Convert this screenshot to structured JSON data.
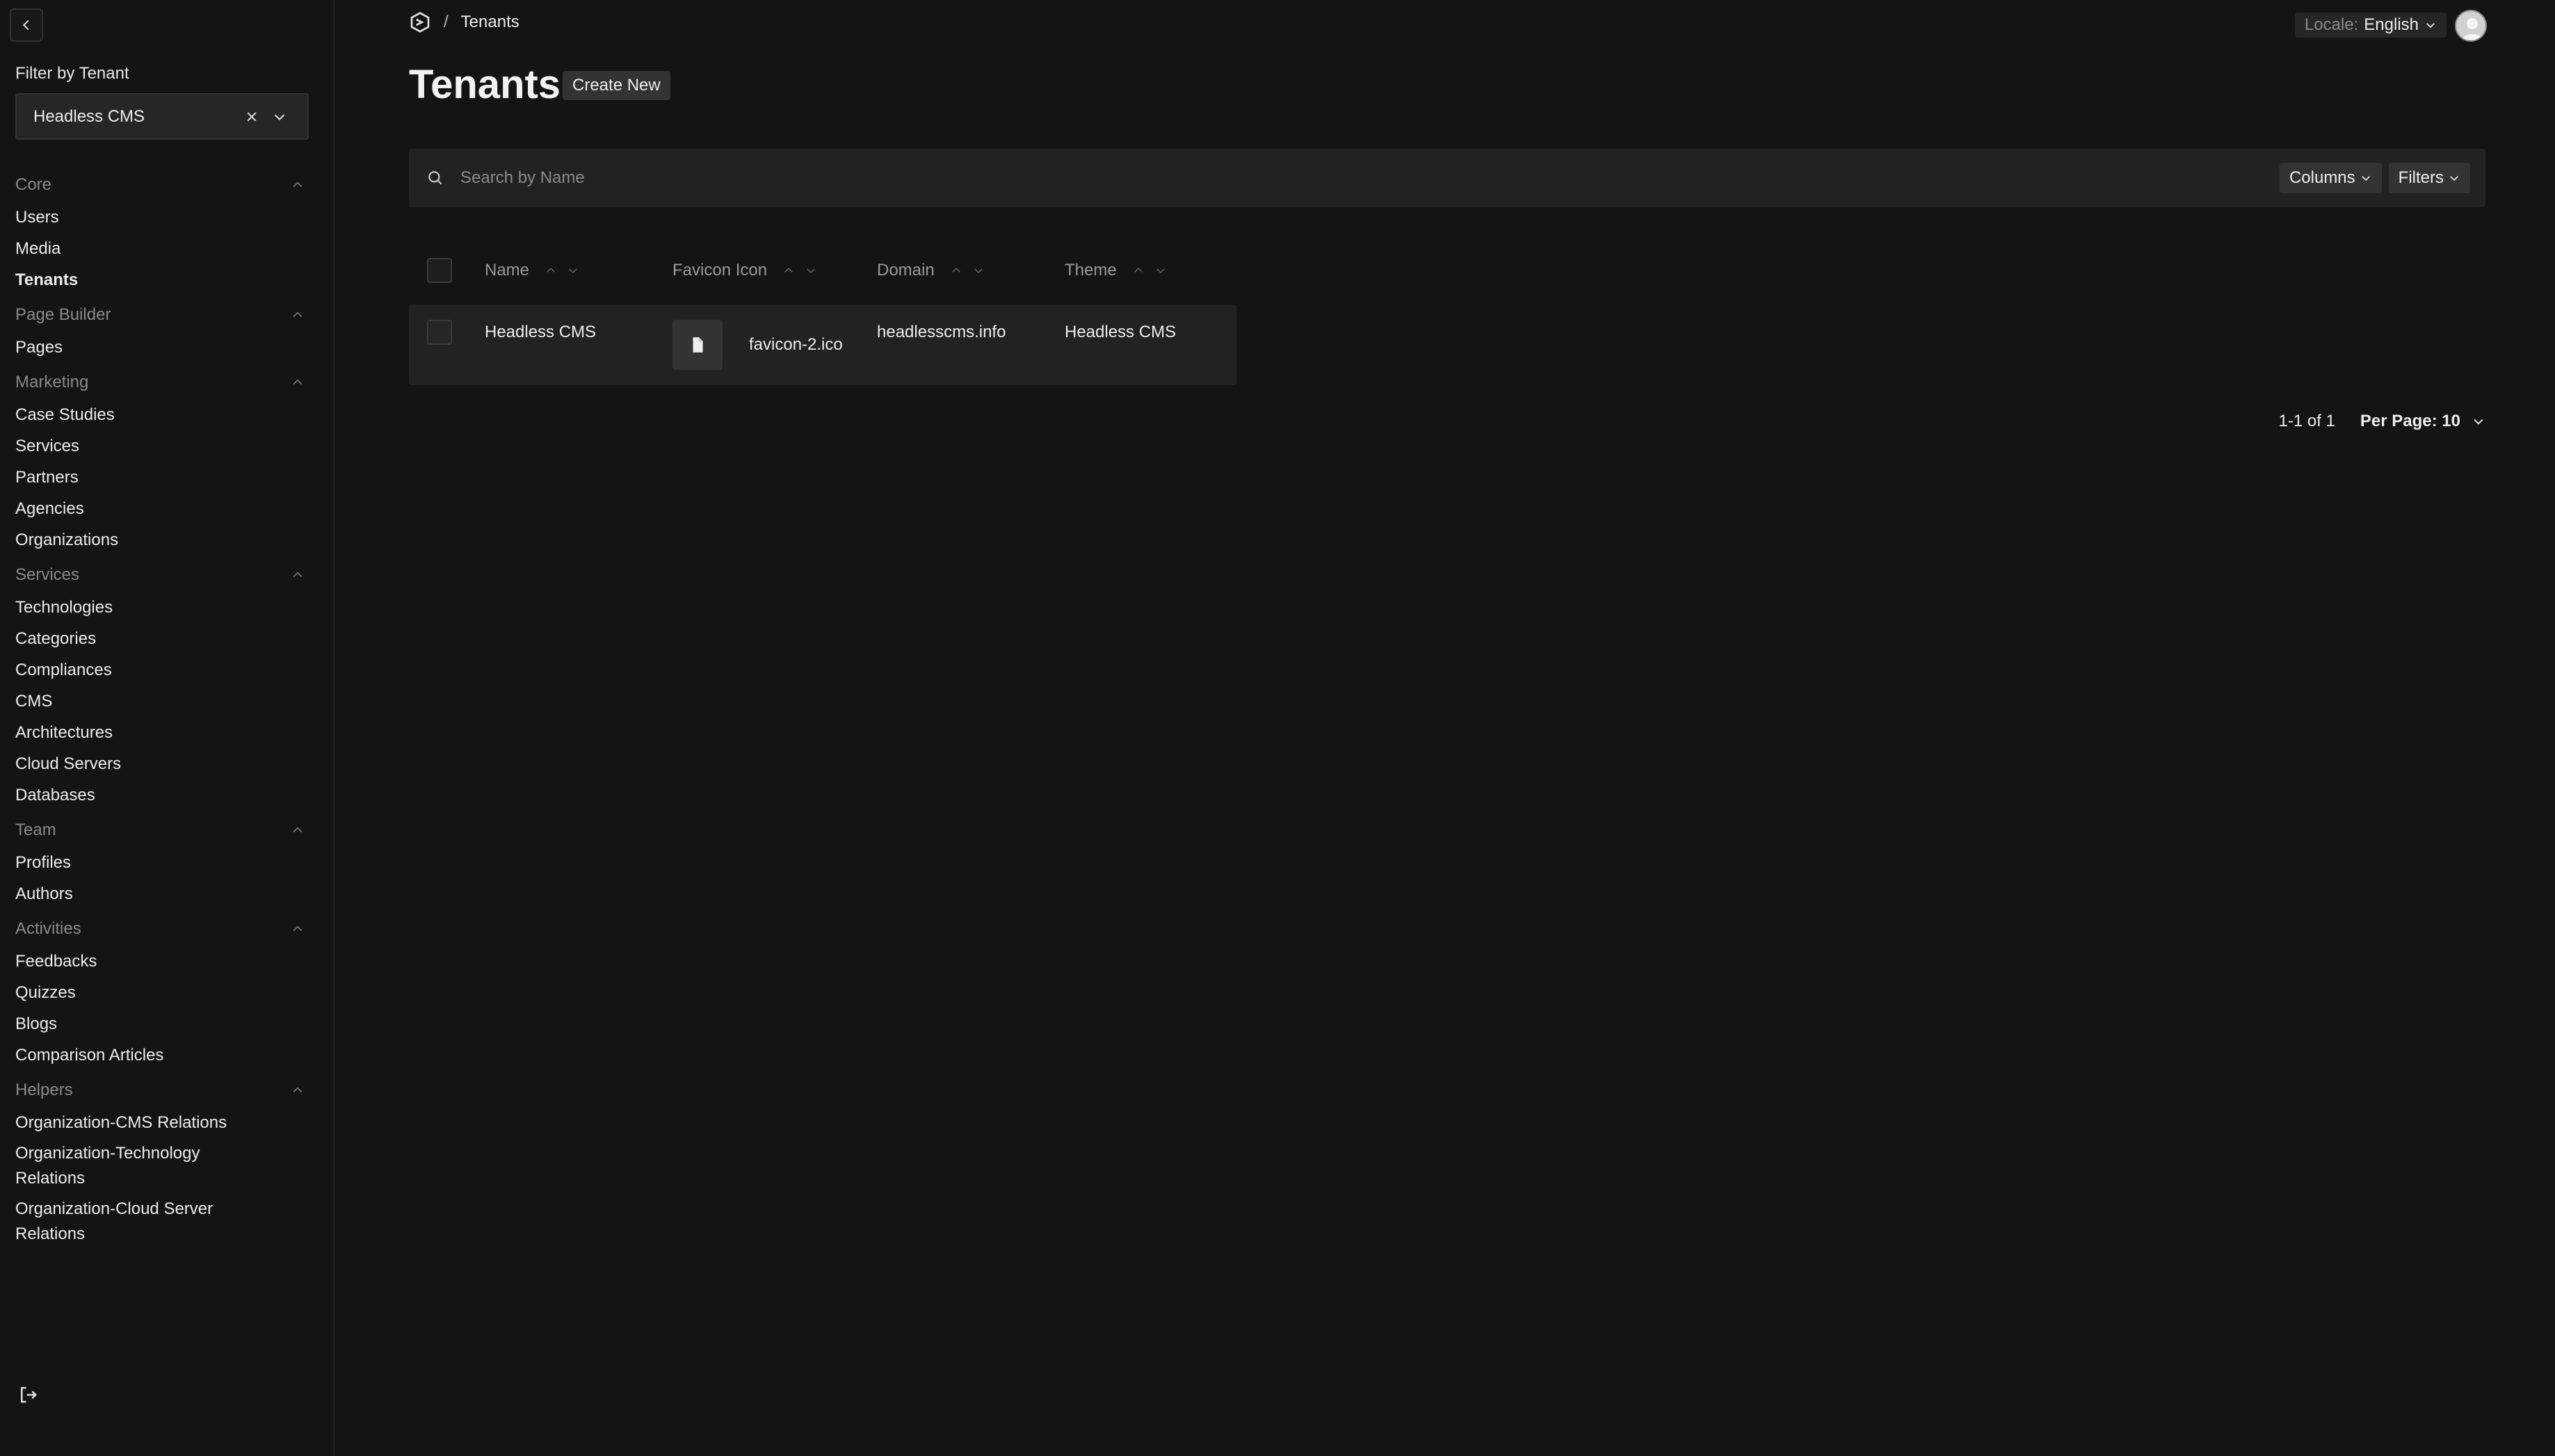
{
  "sidebar": {
    "filter_label": "Filter by Tenant",
    "tenant_value": "Headless CMS",
    "groups": [
      {
        "label": "Core",
        "items": [
          {
            "label": "Users"
          },
          {
            "label": "Media"
          },
          {
            "label": "Tenants",
            "active": true
          }
        ]
      },
      {
        "label": "Page Builder",
        "items": [
          {
            "label": "Pages"
          }
        ]
      },
      {
        "label": "Marketing",
        "items": [
          {
            "label": "Case Studies"
          },
          {
            "label": "Services"
          },
          {
            "label": "Partners"
          },
          {
            "label": "Agencies"
          },
          {
            "label": "Organizations"
          }
        ]
      },
      {
        "label": "Services",
        "items": [
          {
            "label": "Technologies"
          },
          {
            "label": "Categories"
          },
          {
            "label": "Compliances"
          },
          {
            "label": "CMS"
          },
          {
            "label": "Architectures"
          },
          {
            "label": "Cloud Servers"
          },
          {
            "label": "Databases"
          }
        ]
      },
      {
        "label": "Team",
        "items": [
          {
            "label": "Profiles"
          },
          {
            "label": "Authors"
          }
        ]
      },
      {
        "label": "Activities",
        "items": [
          {
            "label": "Feedbacks"
          },
          {
            "label": "Quizzes"
          },
          {
            "label": "Blogs"
          },
          {
            "label": "Comparison Articles"
          }
        ]
      },
      {
        "label": "Helpers",
        "items": [
          {
            "label": "Organization-CMS Relations"
          },
          {
            "label": "Organization-Technology Relations"
          },
          {
            "label": "Organization-Cloud Server Relations"
          }
        ]
      }
    ]
  },
  "header": {
    "breadcrumb_sep": "/",
    "breadcrumb": "Tenants",
    "locale_label": "Locale:",
    "locale_value": "English"
  },
  "main": {
    "title": "Tenants",
    "create_label": "Create New",
    "search_placeholder": "Search by Name",
    "columns_label": "Columns",
    "filters_label": "Filters",
    "table": {
      "headers": [
        "Name",
        "Favicon Icon",
        "Domain",
        "Theme"
      ],
      "rows": [
        {
          "name": "Headless CMS",
          "favicon": "favicon-2.ico",
          "domain": "headlesscms.info",
          "theme": "Headless CMS"
        }
      ]
    },
    "pager": {
      "range": "1-1 of 1",
      "per_page": "Per Page: 10"
    }
  },
  "icons": {
    "back": "chevron-left-icon",
    "logo": "payload-logo-icon",
    "clear": "close-icon",
    "chevron": "chevron-down-icon",
    "search": "search-icon",
    "file": "file-icon",
    "logout": "logout-icon"
  }
}
